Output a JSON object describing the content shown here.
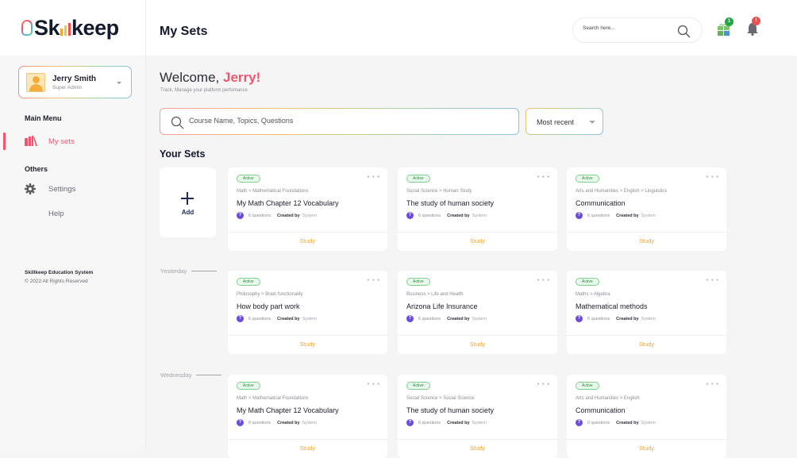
{
  "app": {
    "logo": "Skillkeep",
    "page_title": "My Sets"
  },
  "colors": {
    "accent": "#f0566f",
    "study": "#f2a530",
    "active_badge": "#2e8b3e",
    "question_icon": "#6c4bdb"
  },
  "header": {
    "search_placeholder": "Search here...",
    "gift_badge": "1",
    "notification_badge": "!"
  },
  "profile": {
    "name": "Jerry Smith",
    "role": "Super Admin"
  },
  "sidebar": {
    "main_menu_title": "Main Menu",
    "main_items": [
      {
        "label": "My sets",
        "icon": "books-icon",
        "active": true
      }
    ],
    "others_title": "Others",
    "other_items": [
      {
        "label": "Settings",
        "icon": "gear-icon"
      },
      {
        "label": "Help"
      }
    ],
    "footer_company": "Skillkeep Education System",
    "footer_copyright": "© 2022 All Rights Reserved"
  },
  "main": {
    "welcome_prefix": "Welcome, ",
    "welcome_name": "Jerry!",
    "subtitle": "Track, Manage your platform perfomance",
    "search_placeholder": "Course Name, Topics, Questions",
    "sort_value": "Most recent",
    "section_title": "Your Sets",
    "add_label": "Add",
    "groups": [
      {
        "label": "",
        "cards": [
          {
            "status": "Active",
            "crumb": "Math > Mathematical Foundations",
            "title": "My Math Chapter 12 Vocabulary",
            "questions": "6 questions",
            "created_by_label": "Created by",
            "creator": "System",
            "action": "Study"
          },
          {
            "status": "Active",
            "crumb": "Social Science > Human Study",
            "title": "The study of human society",
            "questions": "6 questions",
            "created_by_label": "Created by",
            "creator": "System",
            "action": "Study"
          },
          {
            "status": "Active",
            "crumb": "Arts and Humanities > English > Linguistics",
            "title": "Communication",
            "questions": "6 questions",
            "created_by_label": "Created by",
            "creator": "System",
            "action": "Study"
          }
        ]
      },
      {
        "label": "Yesterday",
        "cards": [
          {
            "status": "Active",
            "crumb": "Philosophy > Brain functionality",
            "title": "How body part work",
            "questions": "6 questions",
            "created_by_label": "Created by",
            "creator": "System",
            "action": "Study"
          },
          {
            "status": "Active",
            "crumb": "Business > Life and Health",
            "title": "Arizona Life Insurance",
            "questions": "6 questions",
            "created_by_label": "Created by",
            "creator": "System",
            "action": "Study"
          },
          {
            "status": "Active",
            "crumb": "Maths > Algebra",
            "title": "Mathematical methods",
            "questions": "6 questions",
            "created_by_label": "Created by",
            "creator": "System",
            "action": "Study"
          }
        ]
      },
      {
        "label": "Wednesday",
        "cards": [
          {
            "status": "Active",
            "crumb": "Math > Mathematical Foundations",
            "title": "My Math Chapter 12 Vocabulary",
            "questions": "6 questions",
            "created_by_label": "Created by",
            "creator": "System",
            "action": "Study"
          },
          {
            "status": "Active",
            "crumb": "Social Science > Social Science",
            "title": "The study of human society",
            "questions": "6 questions",
            "created_by_label": "Created by",
            "creator": "System",
            "action": "Study"
          },
          {
            "status": "Active",
            "crumb": "Arts and Humanities > English",
            "title": "Communication",
            "questions": "6 questions",
            "created_by_label": "Created by",
            "creator": "System",
            "action": "Study"
          }
        ]
      }
    ]
  }
}
